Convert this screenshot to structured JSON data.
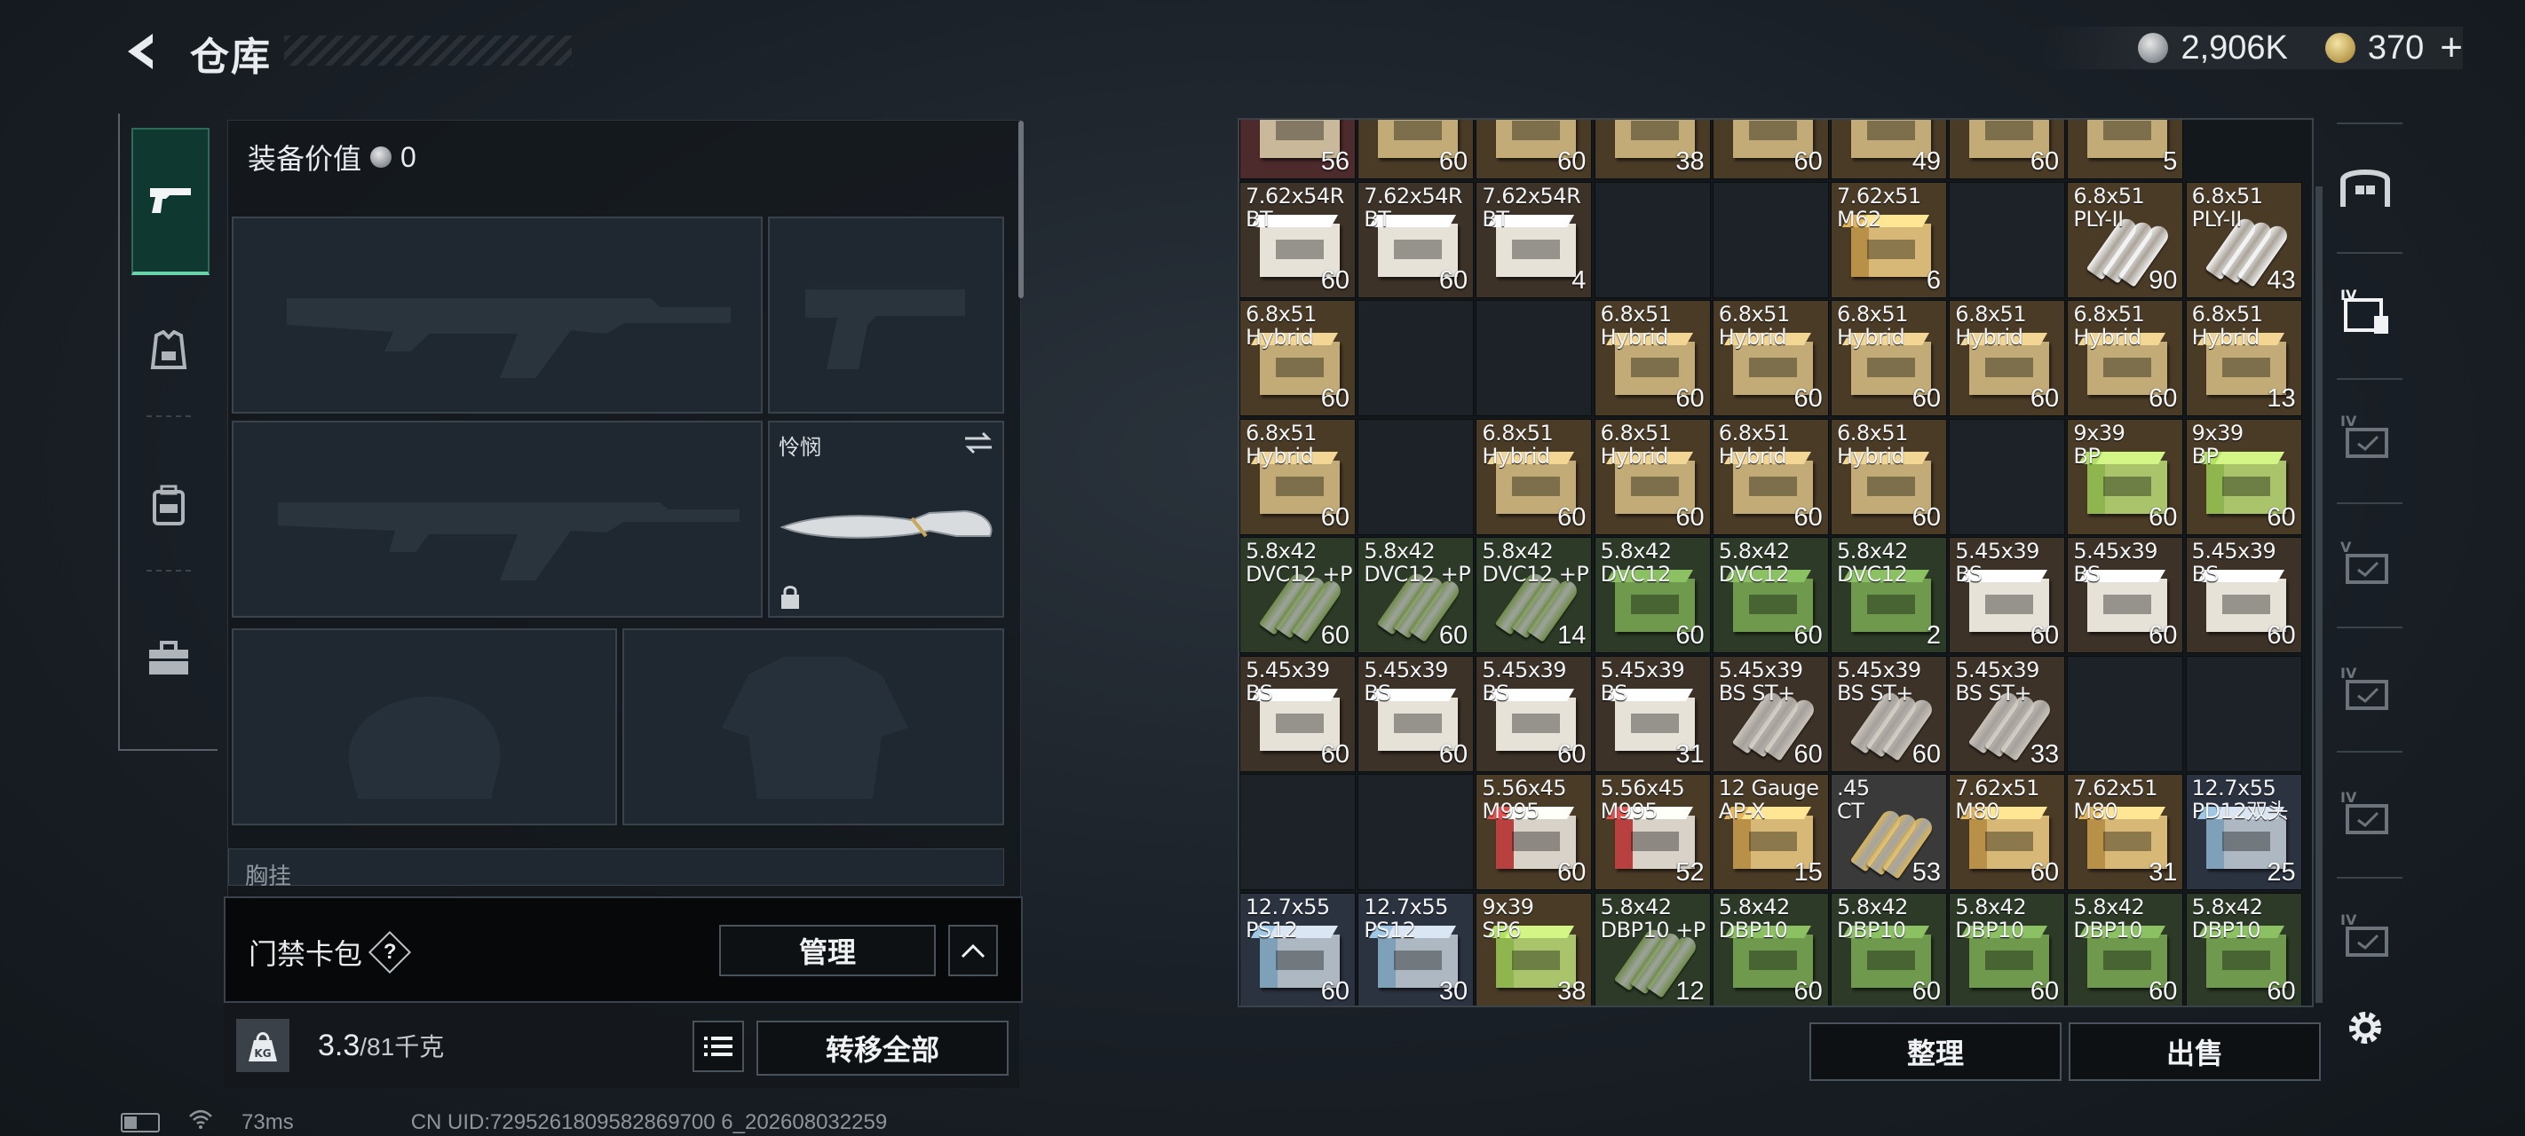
{
  "header": {
    "title": "仓库",
    "currency_silver": "2,906K",
    "currency_gold": "370"
  },
  "loadout": {
    "value_label": "装备价值",
    "value": "0",
    "melee_name": "怜悯",
    "chest_label": "胸挂"
  },
  "access": {
    "label": "门禁卡包",
    "help": "?",
    "manage": "管理"
  },
  "weight": {
    "current": "3.3",
    "max": "/81千克",
    "transfer_all": "转移全部"
  },
  "inventory": {
    "rows": [
      [
        {
          "n": "",
          "c": "56",
          "t": "pink"
        },
        {
          "n": "",
          "c": "60",
          "t": "tan"
        },
        {
          "n": "",
          "c": "60",
          "t": "tan"
        },
        {
          "n": "",
          "c": "38",
          "t": "tan"
        },
        {
          "n": "",
          "c": "60",
          "t": "tan"
        },
        {
          "n": "",
          "c": "49",
          "t": "tan"
        },
        {
          "n": "",
          "c": "60",
          "t": "tan"
        },
        {
          "n": "",
          "c": "5",
          "t": "tan"
        }
      ],
      [
        {
          "n": "7.62x54R\nBT",
          "c": "60",
          "t": "white"
        },
        {
          "n": "7.62x54R\nBT",
          "c": "60",
          "t": "white"
        },
        {
          "n": "7.62x54R\nBT",
          "c": "4",
          "t": "white"
        },
        {
          "n": "",
          "c": "",
          "t": "empty"
        },
        {
          "n": "",
          "c": "",
          "t": "empty"
        },
        {
          "n": "7.62x51\nM62",
          "c": "6",
          "t": "gold"
        },
        {
          "n": "",
          "c": "",
          "t": "empty"
        },
        {
          "n": "6.8x51\nPLY-II",
          "c": "90",
          "t": "bullet-white"
        },
        {
          "n": "6.8x51\nPLY-II",
          "c": "43",
          "t": "bullet-white"
        }
      ],
      [
        {
          "n": "6.8x51\nHybrid",
          "c": "60",
          "t": "tan"
        },
        {
          "n": "",
          "c": "",
          "t": "empty"
        },
        {
          "n": "",
          "c": "",
          "t": "empty"
        },
        {
          "n": "6.8x51\nHybrid",
          "c": "60",
          "t": "tan"
        },
        {
          "n": "6.8x51\nHybrid",
          "c": "60",
          "t": "tan"
        },
        {
          "n": "6.8x51\nHybrid",
          "c": "60",
          "t": "tan"
        },
        {
          "n": "6.8x51\nHybrid",
          "c": "60",
          "t": "tan"
        },
        {
          "n": "6.8x51\nHybrid",
          "c": "60",
          "t": "tan"
        },
        {
          "n": "6.8x51\nHybrid",
          "c": "13",
          "t": "tan"
        }
      ],
      [
        {
          "n": "6.8x51\nHybrid",
          "c": "60",
          "t": "tan"
        },
        {
          "n": "",
          "c": "",
          "t": "empty"
        },
        {
          "n": "6.8x51\nHybrid",
          "c": "60",
          "t": "tan"
        },
        {
          "n": "6.8x51\nHybrid",
          "c": "60",
          "t": "tan"
        },
        {
          "n": "6.8x51\nHybrid",
          "c": "60",
          "t": "tan"
        },
        {
          "n": "6.8x51\nHybrid",
          "c": "60",
          "t": "tan"
        },
        {
          "n": "",
          "c": "",
          "t": "empty"
        },
        {
          "n": "9x39\nBP",
          "c": "60",
          "t": "lime"
        },
        {
          "n": "9x39\nBP",
          "c": "60",
          "t": "lime"
        }
      ],
      [
        {
          "n": "5.8x42\nDVC12 +P",
          "c": "60",
          "t": "bullet-green"
        },
        {
          "n": "5.8x42\nDVC12 +P",
          "c": "60",
          "t": "bullet-green"
        },
        {
          "n": "5.8x42\nDVC12 +P",
          "c": "14",
          "t": "bullet-green"
        },
        {
          "n": "5.8x42\nDVC12",
          "c": "60",
          "t": "green"
        },
        {
          "n": "5.8x42\nDVC12",
          "c": "60",
          "t": "green"
        },
        {
          "n": "5.8x42\nDVC12",
          "c": "2",
          "t": "green"
        },
        {
          "n": "5.45x39\nBS",
          "c": "60",
          "t": "white"
        },
        {
          "n": "5.45x39\nBS",
          "c": "60",
          "t": "white"
        },
        {
          "n": "5.45x39\nBS",
          "c": "60",
          "t": "white"
        }
      ],
      [
        {
          "n": "5.45x39\nBS",
          "c": "60",
          "t": "white"
        },
        {
          "n": "5.45x39\nBS",
          "c": "60",
          "t": "white"
        },
        {
          "n": "5.45x39\nBS",
          "c": "60",
          "t": "white"
        },
        {
          "n": "5.45x39\nBS",
          "c": "31",
          "t": "white"
        },
        {
          "n": "5.45x39\nBS ST+",
          "c": "60",
          "t": "bullet-silver"
        },
        {
          "n": "5.45x39\nBS ST+",
          "c": "60",
          "t": "bullet-silver"
        },
        {
          "n": "5.45x39\nBS ST+",
          "c": "33",
          "t": "bullet-silver"
        },
        {
          "n": "",
          "c": "",
          "t": "empty"
        },
        {
          "n": "",
          "c": "",
          "t": "empty"
        }
      ],
      [
        {
          "n": "",
          "c": "",
          "t": "empty"
        },
        {
          "n": "",
          "c": "",
          "t": "empty"
        },
        {
          "n": "5.56x45\nM995",
          "c": "60",
          "t": "red"
        },
        {
          "n": "5.56x45\nM995",
          "c": "52",
          "t": "red"
        },
        {
          "n": "12 Gauge\nAP-X",
          "c": "15",
          "t": "gold"
        },
        {
          "n": ".45\nCT",
          "c": "53",
          "t": "bullet-gold"
        },
        {
          "n": "7.62x51\nM80",
          "c": "60",
          "t": "gold"
        },
        {
          "n": "7.62x51\nM80",
          "c": "31",
          "t": "gold"
        },
        {
          "n": "12.7x55\nPD12双头",
          "c": "25",
          "t": "silver"
        }
      ],
      [
        {
          "n": "12.7x55\nPS12",
          "c": "60",
          "t": "silver"
        },
        {
          "n": "12.7x55\nPS12",
          "c": "30",
          "t": "silver"
        },
        {
          "n": "9x39\nSP6",
          "c": "38",
          "t": "lime"
        },
        {
          "n": "5.8x42\nDBP10 +P",
          "c": "12",
          "t": "bullet-green"
        },
        {
          "n": "5.8x42\nDBP10",
          "c": "60",
          "t": "green"
        },
        {
          "n": "5.8x42\nDBP10",
          "c": "60",
          "t": "green"
        },
        {
          "n": "5.8x42\nDBP10",
          "c": "60",
          "t": "green"
        },
        {
          "n": "5.8x42\nDBP10",
          "c": "60",
          "t": "green"
        },
        {
          "n": "5.8x42\nDBP10",
          "c": "60",
          "t": "green"
        }
      ]
    ],
    "sort_label": "整理",
    "sell_label": "出售"
  },
  "status": {
    "ping": "73ms",
    "uid": "CN UID:7295261809582869700 6_202608032259"
  },
  "colors": {
    "accent": "#6ad2a8",
    "cell_tan": "#4a3b27",
    "cell_pink": "#4d2a2c",
    "cell_white": "#3c3228",
    "cell_green": "#2d3a27",
    "cell_blue": "#2c3340"
  }
}
